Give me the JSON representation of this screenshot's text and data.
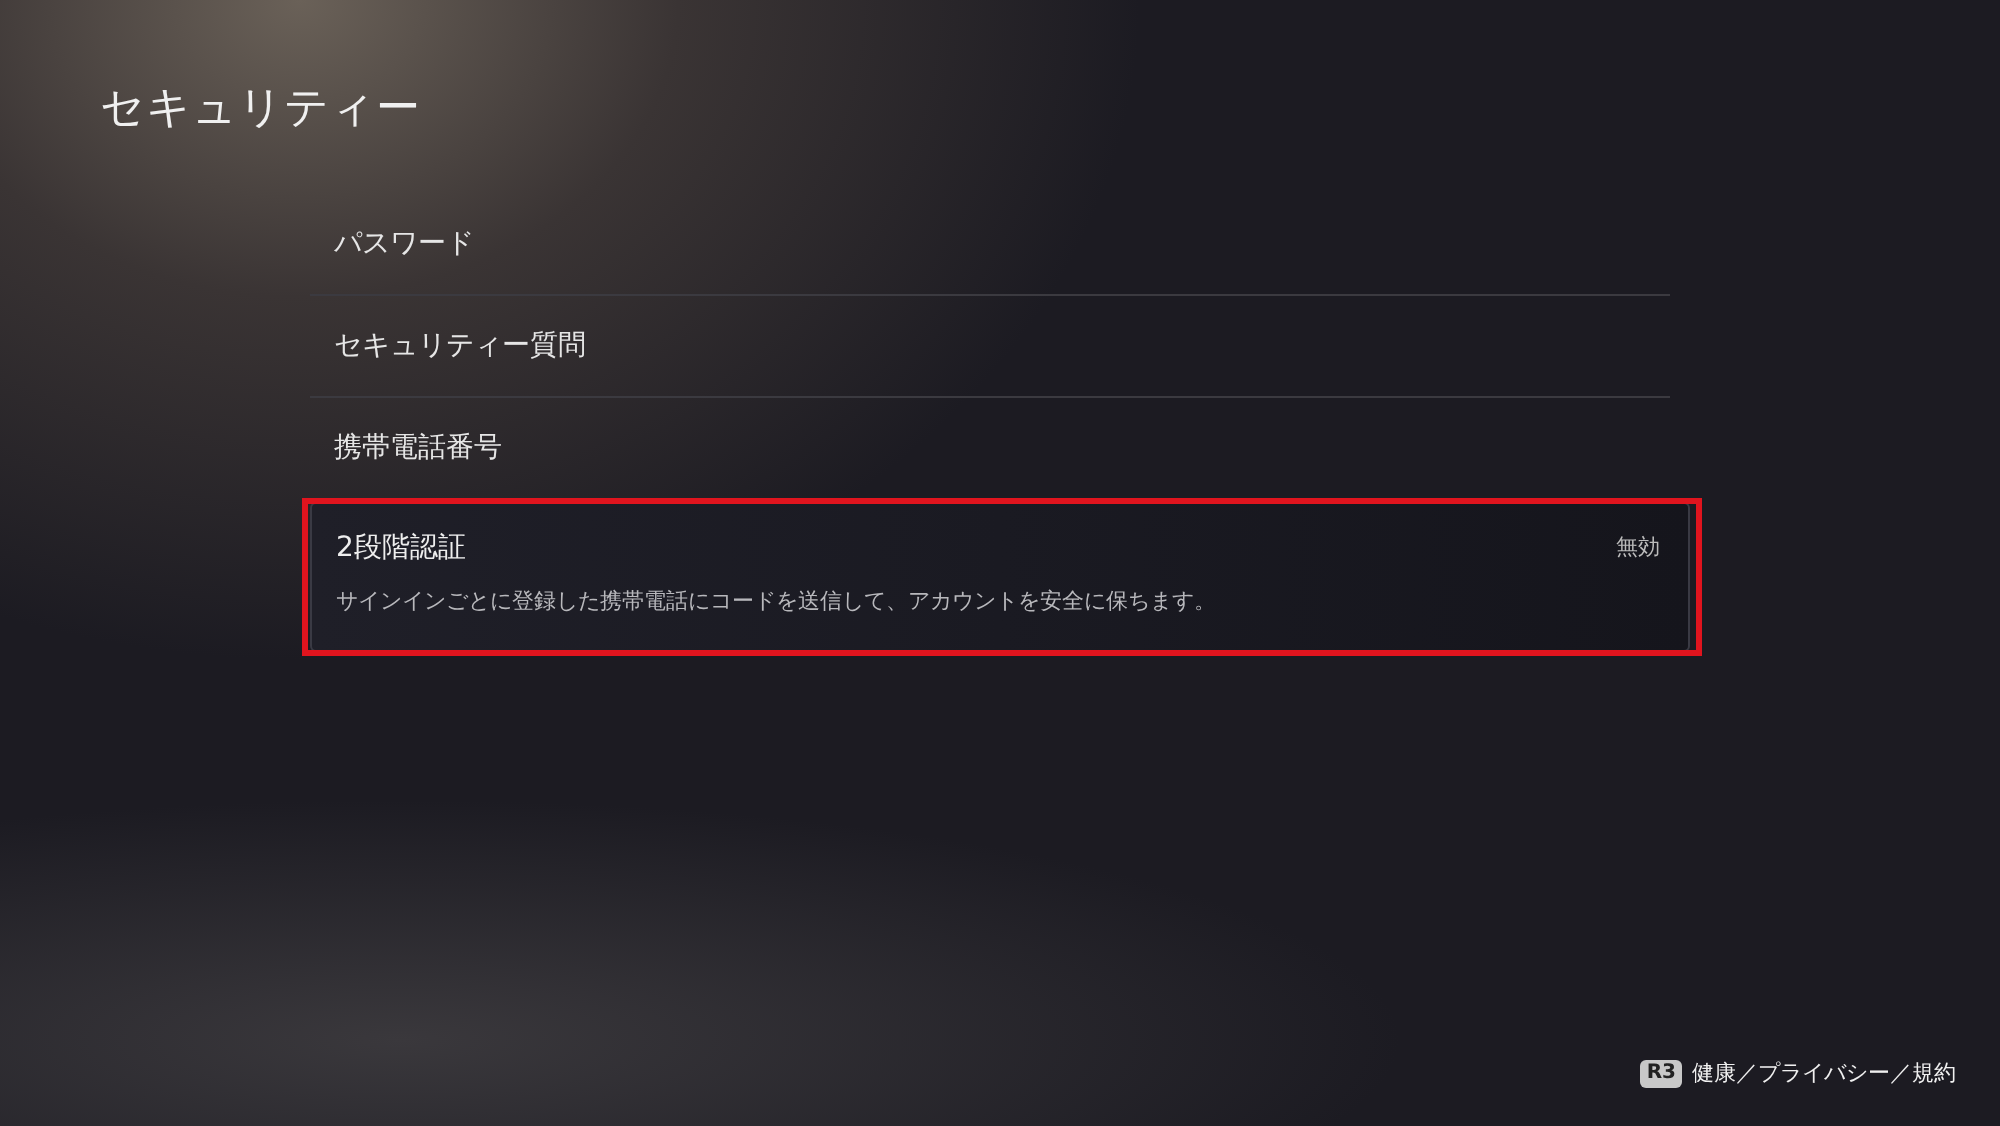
{
  "title": "セキュリティー",
  "items": [
    {
      "label": "パスワード",
      "selected": false
    },
    {
      "label": "セキュリティー質問",
      "selected": false
    },
    {
      "label": "携帯電話番号",
      "selected": false
    },
    {
      "label": "2段階認証",
      "selected": true,
      "value": "無効",
      "description": "サインインごとに登録した携帯電話にコードを送信して、アカウントを安全に保ちます。"
    }
  ],
  "footer": {
    "key": "R3",
    "label": "健康／プライバシー／規約"
  }
}
